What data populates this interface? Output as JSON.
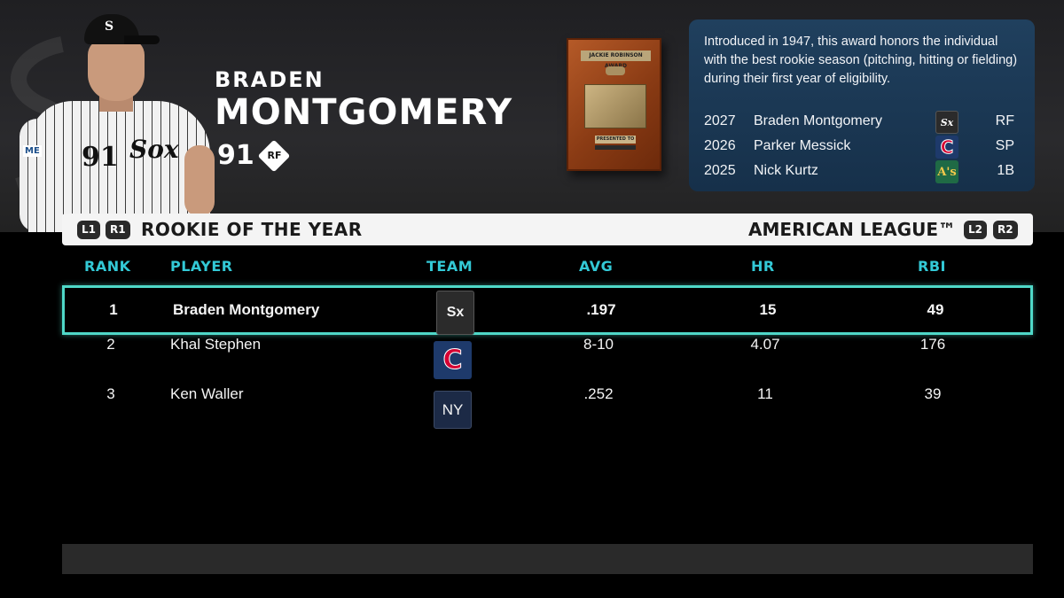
{
  "player": {
    "first_name": "BRADEN",
    "last_name": "MONTGOMERY",
    "overall": "91",
    "position": "RF",
    "jersey_number": "91",
    "sleeve_badge": "ME"
  },
  "award": {
    "plaque_title": "JACKIE ROBINSON AWARD",
    "plaque_sub": "PRESENTED TO",
    "description": "Introduced in 1947, this award honors the individual with the best rookie season (pitching, hitting or fielding) during their first year of eligibility.",
    "winners": [
      {
        "year": "2027",
        "name": "Braden Montgomery",
        "team_icon": "white-sox-logo-icon",
        "position": "RF"
      },
      {
        "year": "2026",
        "name": "Parker Messick",
        "team_icon": "guardians-logo-icon",
        "position": "SP"
      },
      {
        "year": "2025",
        "name": "Nick Kurtz",
        "team_icon": "athletics-logo-icon",
        "position": "1B"
      }
    ]
  },
  "header_bar": {
    "left_buttons": [
      "L1",
      "R1"
    ],
    "title": "ROOKIE OF THE YEAR",
    "league": "AMERICAN LEAGUE™",
    "right_buttons": [
      "L2",
      "R2"
    ]
  },
  "table": {
    "columns": [
      "RANK",
      "PLAYER",
      "TEAM",
      "AVG",
      "HR",
      "RBI"
    ],
    "rows": [
      {
        "rank": "1",
        "player": "Braden Montgomery",
        "team_icon": "white-sox-logo-icon",
        "avg": ".197",
        "hr": "15",
        "rbi": "49",
        "selected": true
      },
      {
        "rank": "2",
        "player": "Khal Stephen",
        "team_icon": "guardians-logo-icon",
        "avg": "8-10",
        "hr": "4.07",
        "rbi": "176",
        "selected": false
      },
      {
        "rank": "3",
        "player": "Ken Waller",
        "team_icon": "yankees-logo-icon",
        "avg": ".252",
        "hr": "11",
        "rbi": "39",
        "selected": false
      }
    ]
  },
  "colors": {
    "accent_cyan": "#33c9d6",
    "selection_border": "#4fd8c8",
    "info_card_bg": "#1c3956",
    "header_bar_bg": "#f4f4f4"
  }
}
